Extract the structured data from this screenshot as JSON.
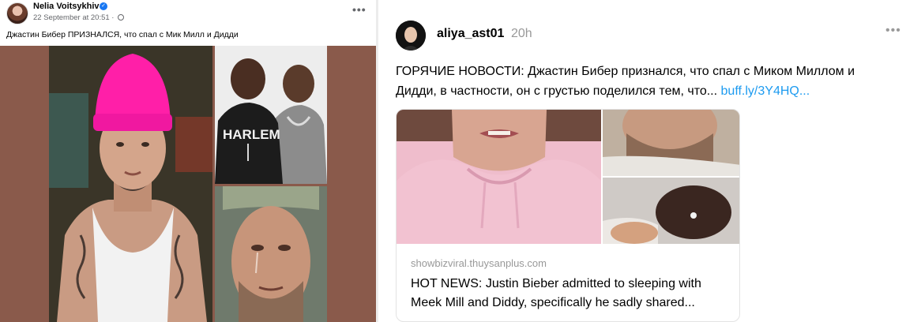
{
  "facebook_post": {
    "author": "Nelia Voitsykhiv",
    "timestamp": "22 September at 20:51 ·",
    "more_label": "•••",
    "text": "Джастин Бибер ПРИЗНАЛСЯ, что спал с Мик Милл и Дидди",
    "photo_text": "HARLEM",
    "icons": [
      "verified-badge-icon",
      "globe-icon",
      "more-icon"
    ]
  },
  "threads_post": {
    "username": "aliya_ast01",
    "time": "20h",
    "more_label": "•••",
    "text": "ГОРЯЧИЕ НОВОСТИ: Джастин Бибер признался, что спал с Миком Миллом и Дидди, в частности, он с грустью поделился тем, что...",
    "link": "buff.ly/3Y4HQ...",
    "card": {
      "domain": "showbizviral.thuysanplus.com",
      "title": "HOT NEWS: Justin Bieber admitted to sleeping with Meek Mill and Diddy, specifically he sadly shared..."
    }
  },
  "colors": {
    "facebook_blue": "#1877f2",
    "link_blue": "#1d9bf0",
    "meta_gray": "#65676b",
    "media_background": "#8a5a4b",
    "beanie_pink": "#ff1fa8"
  }
}
